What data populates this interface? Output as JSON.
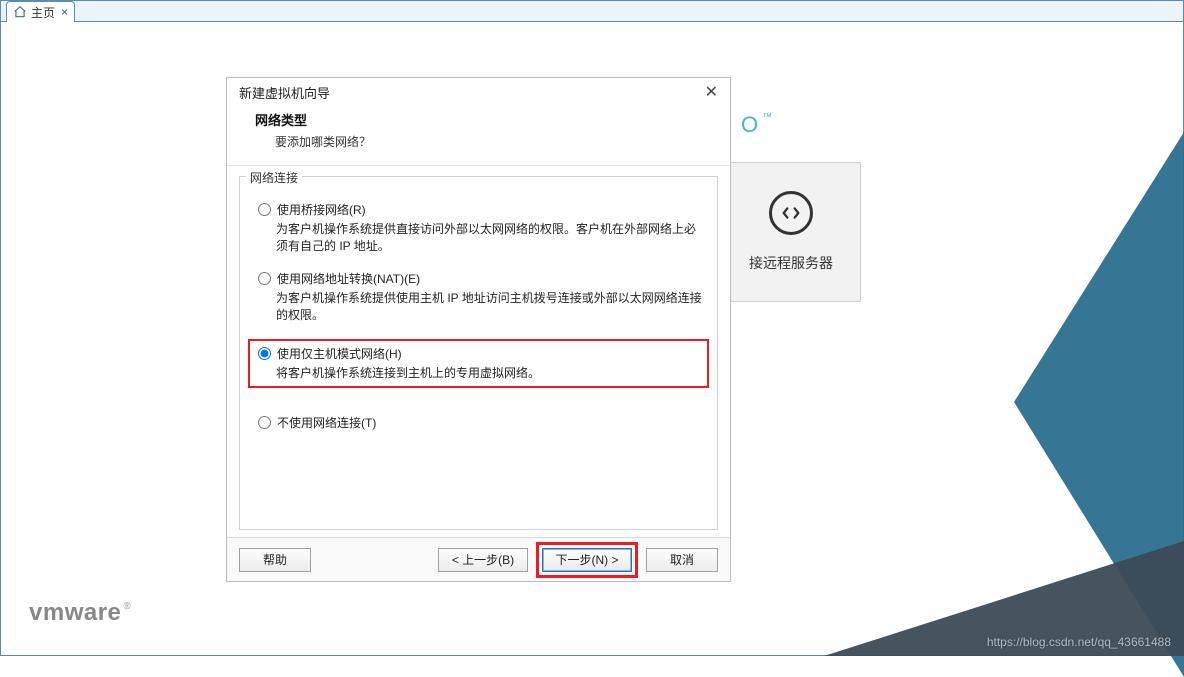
{
  "tab": {
    "label": "主页"
  },
  "pro_label": "O",
  "bg_tile": {
    "label": "接远程服务器"
  },
  "dialog": {
    "title": "新建虚拟机向导",
    "sub_title": "网络类型",
    "sub_question": "要添加哪类网络？",
    "group_legend": "网络连接",
    "options": {
      "bridge": {
        "label": "使用桥接网络(R)",
        "desc": "为客户机操作系统提供直接访问外部以太网网络的权限。客户机在外部网络上必须有自己的 IP 地址。"
      },
      "nat": {
        "label": "使用网络地址转换(NAT)(E)",
        "desc": "为客户机操作系统提供使用主机 IP 地址访问主机拨号连接或外部以太网网络连接的权限。"
      },
      "hostonly": {
        "label": "使用仅主机模式网络(H)",
        "desc": "将客户机操作系统连接到主机上的专用虚拟网络。"
      },
      "none": {
        "label": "不使用网络连接(T)"
      }
    },
    "buttons": {
      "help": "帮助",
      "back": "< 上一步(B)",
      "next": "下一步(N) >",
      "cancel": "取消"
    }
  },
  "logo": "vmware",
  "watermark": "https://blog.csdn.net/qq_43661488"
}
